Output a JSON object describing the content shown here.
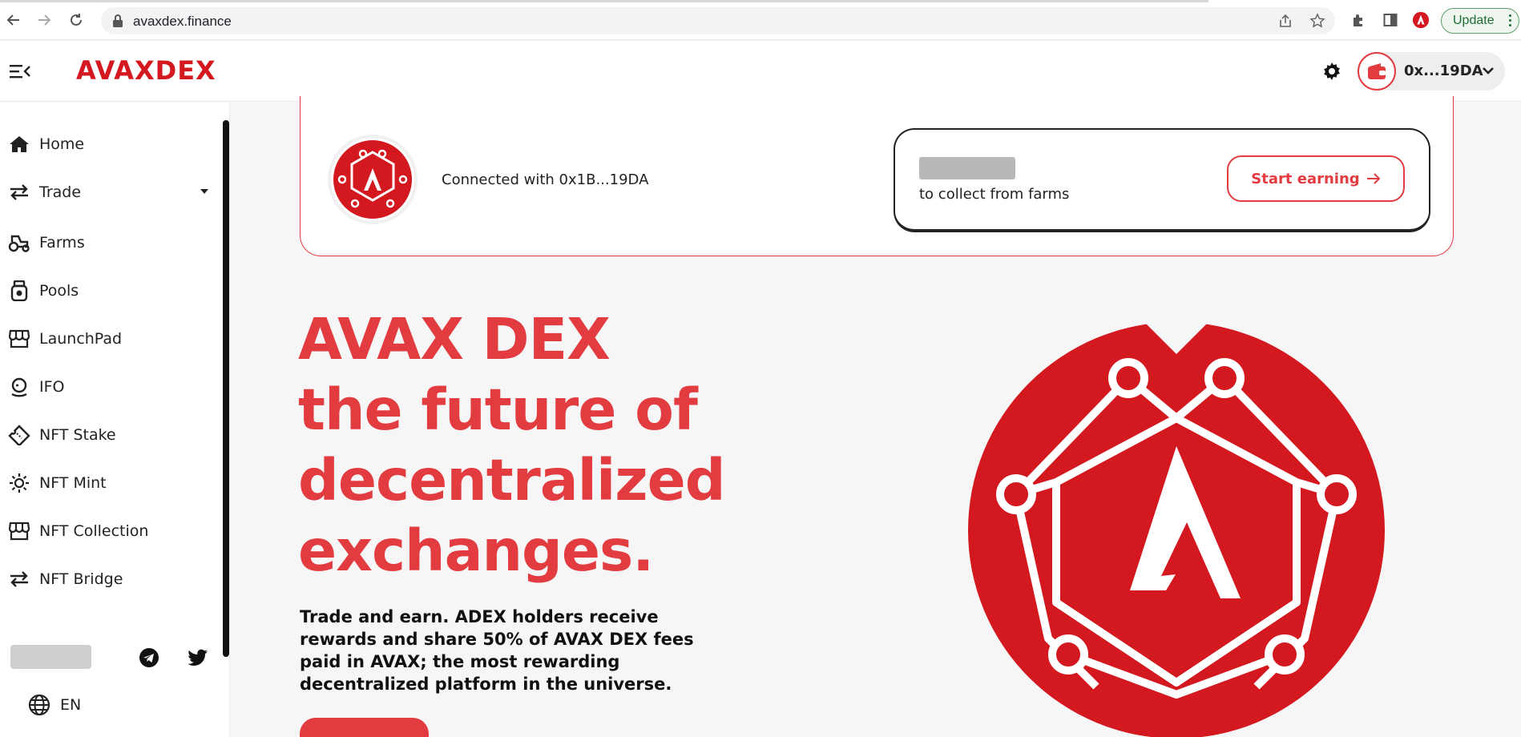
{
  "browser": {
    "url": "avaxdex.finance",
    "update_label": "Update"
  },
  "header": {
    "brand": "AVAXDEX",
    "wallet_address": "0x...19DA"
  },
  "sidebar": {
    "items": [
      {
        "label": "Home",
        "icon": "home-icon"
      },
      {
        "label": "Trade",
        "icon": "swap-arrows-icon"
      },
      {
        "label": "Farms",
        "icon": "tractor-icon"
      },
      {
        "label": "Pools",
        "icon": "pool-jar-icon"
      },
      {
        "label": "LaunchPad",
        "icon": "storefront-icon"
      },
      {
        "label": "IFO",
        "icon": "rocket-launch-icon"
      },
      {
        "label": "NFT Stake",
        "icon": "ticket-icon"
      },
      {
        "label": "NFT Mint",
        "icon": "sun-icon"
      },
      {
        "label": "NFT Collection",
        "icon": "storefront-icon"
      },
      {
        "label": "NFT Bridge",
        "icon": "swap-arrows-icon"
      }
    ],
    "language": "EN"
  },
  "card": {
    "connected_text": "Connected with 0x1B...19DA",
    "collect_text": "to collect from farms",
    "start_earning": "Start earning"
  },
  "hero": {
    "line1": "AVAX DEX",
    "line2": "the future of",
    "line3": "decentralized",
    "line4": "exchanges.",
    "subtitle": "Trade and earn. ADEX holders receive rewards and share 50% of AVAX DEX fees paid in AVAX; the most rewarding decentralized platform in the universe."
  },
  "colors": {
    "brand_red": "#e23b40",
    "logo_red": "#d4181f",
    "dark": "#222222"
  }
}
